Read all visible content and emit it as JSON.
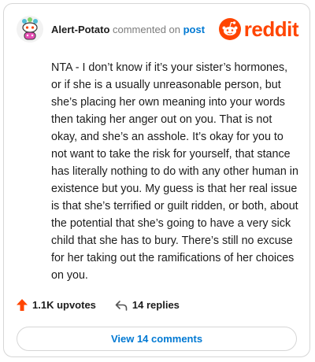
{
  "header": {
    "username": "Alert-Potato",
    "action": " commented on ",
    "link": "post",
    "brand": "reddit"
  },
  "comment": {
    "text": "NTA - I don’t know if it’s your sister’s hormones, or if she is a usually unreasonable person, but she’s placing her own meaning into your words then taking her anger out on you. That is not okay, and she’s an asshole. It’s okay for you to not want to take the risk for yourself, that stance has literally nothing to do with any other human in existence but you. My guess is that her real issue is that she’s terrified or guilt ridden, or both, about the potential that she’s going to have a very sick child that she has to bury. There’s still no excuse for her taking out the ramifications of her choices on you."
  },
  "stats": {
    "upvotes": "1.1K upvotes",
    "replies": "14 replies"
  },
  "button": {
    "view_label": "View 14 comments"
  },
  "colors": {
    "brand": "#ff4500",
    "link": "#0079d3"
  },
  "icons": {
    "avatar": "snoo-avatar-icon",
    "logo": "reddit-alien-icon",
    "upvote": "upvote-arrow-icon",
    "reply": "reply-arrow-icon"
  }
}
